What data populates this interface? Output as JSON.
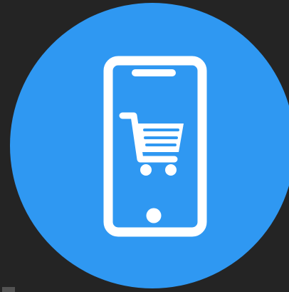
{
  "app_icon": {
    "name": "mobile-shopping",
    "icon": "smartphone-shopping-cart-icon",
    "colors": {
      "background": "#242424",
      "circle": "#2f98f2",
      "glyph": "#ffffff"
    }
  }
}
